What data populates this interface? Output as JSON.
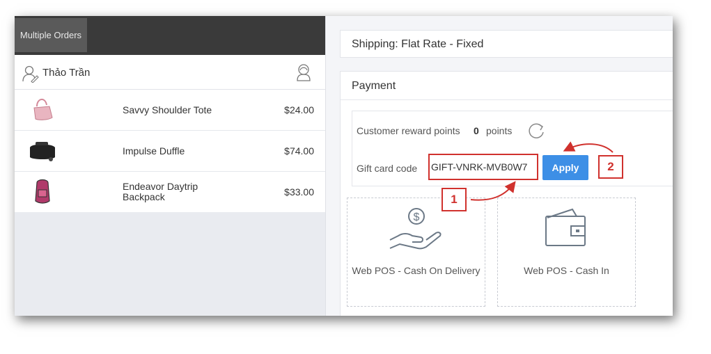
{
  "header": {
    "tab_multiple_orders": "Multiple Orders"
  },
  "customer": {
    "name": "Thảo Trần"
  },
  "cart": {
    "items": [
      {
        "name": "Savvy Shoulder Tote",
        "price": "$24.00",
        "icon": "shoulder-bag-icon"
      },
      {
        "name": "Impulse Duffle",
        "price": "$74.00",
        "icon": "duffle-bag-icon"
      },
      {
        "name": "Endeavor Daytrip Backpack",
        "price": "$33.00",
        "icon": "backpack-icon"
      }
    ]
  },
  "shipping": {
    "label": "Shipping: Flat Rate - Fixed"
  },
  "payment": {
    "title": "Payment",
    "reward_label": "Customer reward points",
    "reward_points": "0",
    "reward_unit": "points",
    "gift_label": "Gift card code",
    "gift_code": "GIFT-VNRK-MVB0W7",
    "apply_label": "Apply",
    "methods": [
      {
        "label": "Web POS - Cash On Delivery",
        "icon": "cash-hand-icon"
      },
      {
        "label": "Web POS - Cash In",
        "icon": "wallet-icon"
      }
    ]
  },
  "annotations": {
    "step1": "1",
    "step2": "2"
  },
  "colors": {
    "accent": "#3d8fe6",
    "annotation": "#d0312d",
    "topbar": "#3a3a3a"
  }
}
